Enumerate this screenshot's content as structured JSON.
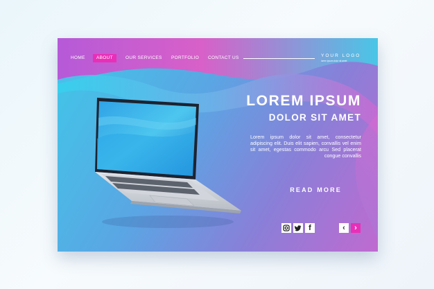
{
  "colors": {
    "accent": "#e92fb7",
    "gradient_cyan": "#3fc8e8",
    "gradient_purple": "#c06ad0",
    "text": "#ffffff"
  },
  "nav": {
    "items": [
      {
        "label": "HOME",
        "active": false
      },
      {
        "label": "ABOUT",
        "active": true
      },
      {
        "label": "OUR SERVICES",
        "active": false
      },
      {
        "label": "PORTFOLIO",
        "active": false
      },
      {
        "label": "CONTACT US",
        "active": false
      }
    ]
  },
  "logo": {
    "title": "YOUR LOGO",
    "tagline": "lorem ipsum dolor sit amet"
  },
  "hero": {
    "title": "LOREM IPSUM",
    "subtitle": "DOLOR SIT AMET",
    "body": "Lorem ipsum dolor sit amet, consectetur adipiscing elit. Duis elit sapien, convallis vel enim sit amet, egestas commodo arcu Sed placerat congue convallis",
    "cta": "READ MORE"
  },
  "social": {
    "icons": [
      "instagram-icon",
      "twitter-icon",
      "facebook-icon"
    ],
    "facebook_glyph": "f"
  },
  "pager": {
    "prev": "‹",
    "next": "›"
  }
}
